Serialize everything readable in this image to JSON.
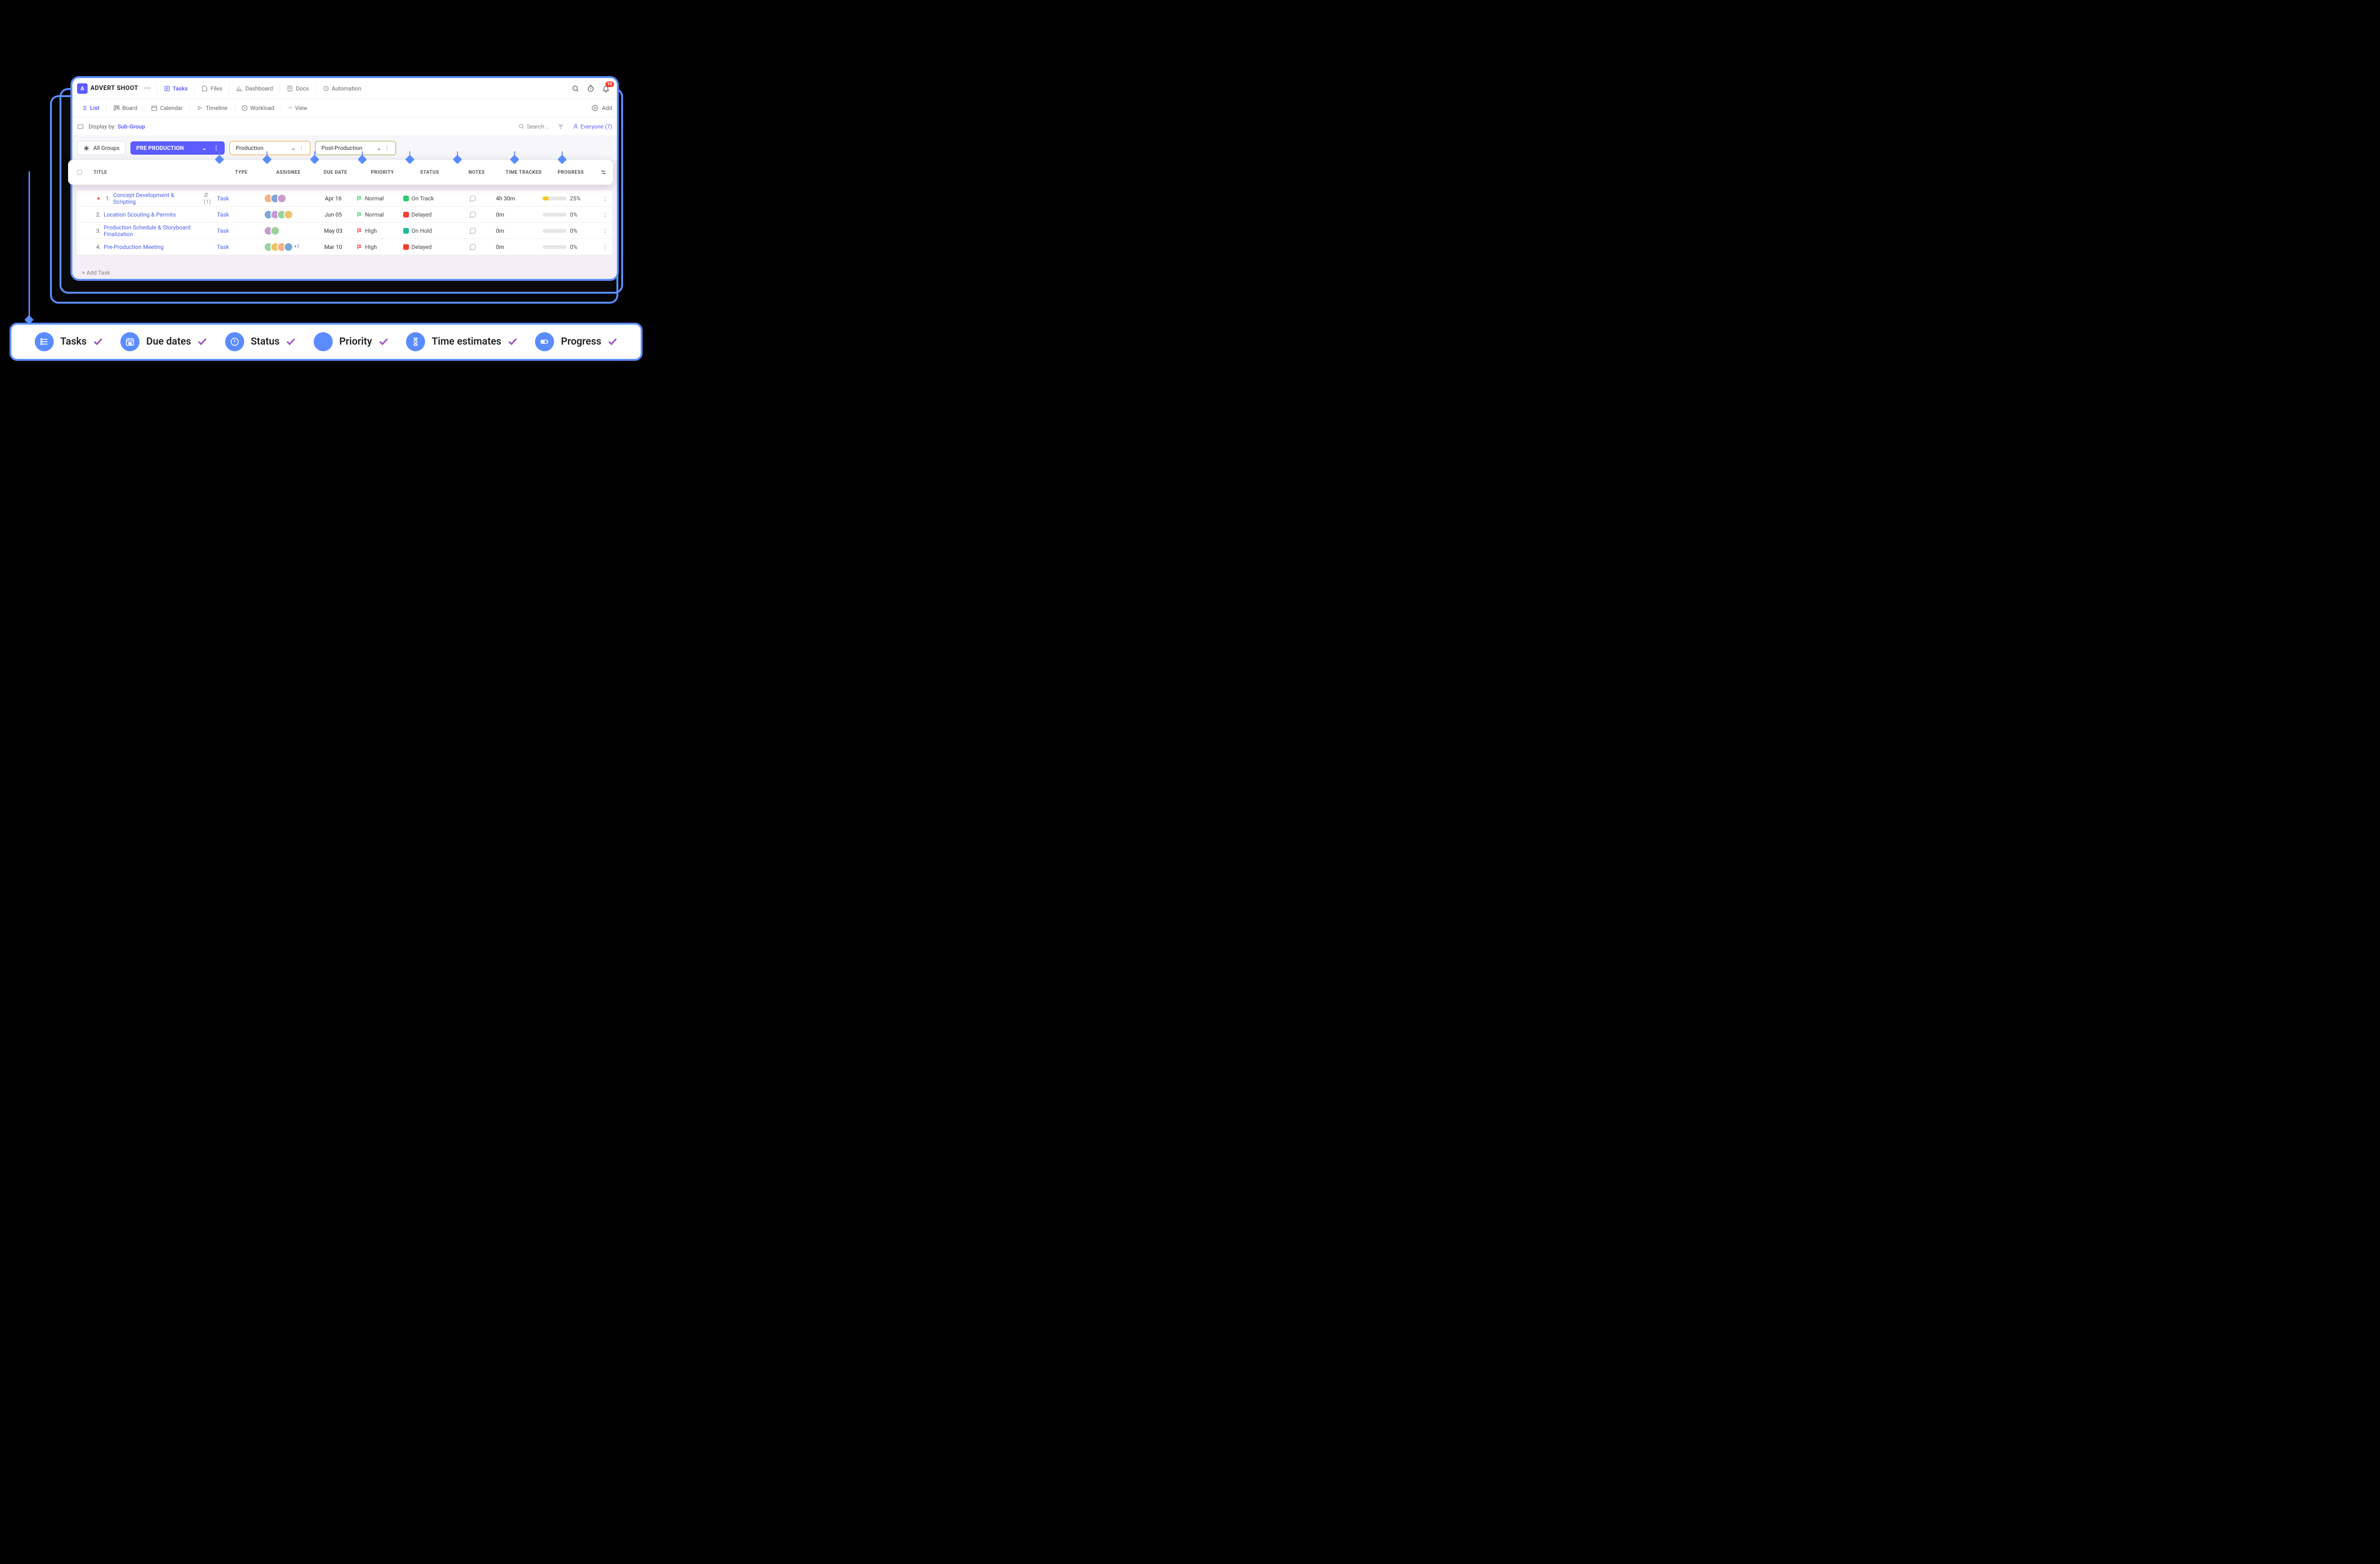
{
  "project": {
    "badge": "A",
    "title": "ADVERT SHOOT"
  },
  "nav": {
    "tasks": "Tasks",
    "files": "Files",
    "dashboard": "Dashboard",
    "docs": "Docs",
    "automation": "Automation"
  },
  "notifications": {
    "count": "10"
  },
  "views": {
    "list": "List",
    "board": "Board",
    "calendar": "Calendar",
    "timeline": "Timeline",
    "workload": "Workload",
    "view": "View",
    "add": "Add"
  },
  "filter": {
    "display_by_label": "Display by:",
    "display_by_value": "Sub-Group",
    "search_placeholder": "Search ..",
    "everyone_label": "Everyone (7)"
  },
  "groups": {
    "all": "All Groups",
    "pre": "PRE PRODUCTION",
    "prod": "Production",
    "post": "Post-Production"
  },
  "columns": {
    "title": "TITLE",
    "type": "TYPE",
    "assignee": "ASSIGNEE",
    "due": "DUE DATE",
    "priority": "PRIORITY",
    "status": "STATUS",
    "notes": "NOTES",
    "time": "TIME TRACKED",
    "progress": "PROGRESS"
  },
  "rows": [
    {
      "num": "1.",
      "title": "Concept Development & Scripting",
      "badges": "(1)",
      "pinned": true,
      "type": "Task",
      "assignees": 3,
      "due": "Apr 16",
      "priority": "Normal",
      "priority_color": "#2ecc71",
      "status": "On Track",
      "status_color": "#2ecc71",
      "time": "4h 30m",
      "progress_pct": 25,
      "progress_label": "25%"
    },
    {
      "num": "2.",
      "title": "Location Scouting & Permits",
      "badges": "",
      "pinned": false,
      "type": "Task",
      "assignees": 4,
      "due": "Jun 05",
      "priority": "Normal",
      "priority_color": "#2ecc71",
      "status": "Delayed",
      "status_color": "#ff3b30",
      "time": "0m",
      "progress_pct": 0,
      "progress_label": "0%"
    },
    {
      "num": "3.",
      "title": "Production Schedule & Storyboard Finalization",
      "badges": "",
      "pinned": false,
      "type": "Task",
      "assignees": 2,
      "due": "May 03",
      "priority": "High",
      "priority_color": "#ff3b30",
      "status": "On Hold",
      "status_color": "#1abc9c",
      "time": "0m",
      "progress_pct": 0,
      "progress_label": "0%"
    },
    {
      "num": "4.",
      "title": "Pre-Production Meeting",
      "badges": "",
      "pinned": false,
      "type": "Task",
      "assignees": 4,
      "extra_count": "+1",
      "due": "Mar 10",
      "priority": "High",
      "priority_color": "#ff3b30",
      "status": "Delayed",
      "status_color": "#ff3b30",
      "time": "0m",
      "progress_pct": 0,
      "progress_label": "0%"
    }
  ],
  "add_task": "+ Add Task",
  "summary": [
    {
      "icon": "checklist",
      "label": "Tasks"
    },
    {
      "icon": "calendar",
      "label": "Due dates"
    },
    {
      "icon": "alert",
      "label": "Status"
    },
    {
      "icon": "dot",
      "label": "Priority"
    },
    {
      "icon": "hourglass",
      "label": "Time estimates"
    },
    {
      "icon": "battery",
      "label": "Progress"
    }
  ]
}
